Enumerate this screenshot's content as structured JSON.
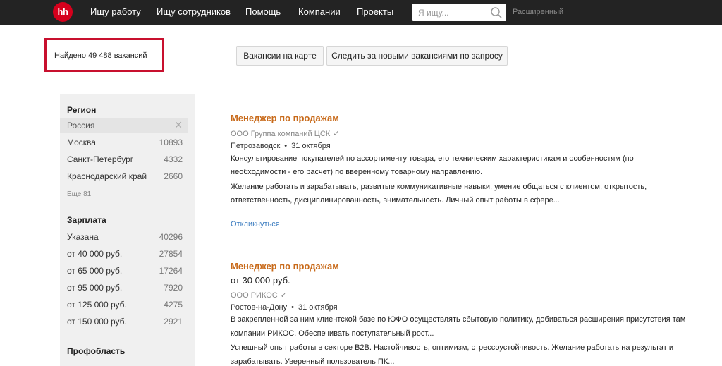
{
  "header": {
    "logo_text": "hh",
    "nav": [
      "Ищу работу",
      "Ищу сотрудников",
      "Помощь",
      "Компании",
      "Проекты"
    ],
    "search_placeholder": "Я ищу...",
    "advanced_label": "Расширенный"
  },
  "results": {
    "found_text": "Найдено 49 488 вакансий",
    "map_button": "Вакансии на карте",
    "subscribe_button": "Следить за новыми вакансиями по запросу"
  },
  "sidebar": {
    "region": {
      "title": "Регион",
      "selected": "Россия",
      "items": [
        {
          "label": "Москва",
          "count": "10893"
        },
        {
          "label": "Санкт-Петербург",
          "count": "4332"
        },
        {
          "label": "Краснодарский край",
          "count": "2660"
        }
      ],
      "more": "Еще 81"
    },
    "salary": {
      "title": "Зарплата",
      "items": [
        {
          "label": "Указана",
          "count": "40296"
        },
        {
          "label": "от 40 000 руб.",
          "count": "27854"
        },
        {
          "label": "от 65 000 руб.",
          "count": "17264"
        },
        {
          "label": "от 95 000 руб.",
          "count": "7920"
        },
        {
          "label": "от 125 000 руб.",
          "count": "4275"
        },
        {
          "label": "от 150 000 руб.",
          "count": "2921"
        }
      ]
    },
    "profarea": {
      "title": "Профобласть"
    }
  },
  "vacancies": [
    {
      "title": "Менеджер по продажам",
      "salary": "",
      "company": "ООО Группа компаний ЦСК",
      "city": "Петрозаводск",
      "date": "31 октября",
      "lines": [
        "Консультирование покупателей по ассортименту товара, его техническим характеристикам и особенностям (по",
        "необходимости - его расчет) по вверенному товарному направлению.",
        "Желание работать и зарабатывать, развитые коммуникативные навыки, умение общаться с клиентом, открытость,",
        "ответственность, дисциплинированность, внимательность. Личный опыт работы в сфере..."
      ],
      "respond": "Откликнуться"
    },
    {
      "title": "Менеджер по продажам",
      "salary": "от 30 000 руб.",
      "company": "ООО РИКОС",
      "city": "Ростов-на-Дону",
      "date": "31 октября",
      "lines": [
        "В закрепленной за ним клиентской базе по ЮФО осуществлять сбытовую политику, добиваться расширения присутствия там",
        "компании РИКОС. Обеспечивать поступательный рост...",
        "Успешный опыт работы в секторе B2B. Настойчивость, оптимизм, стрессоустойчивость. Желание работать на результат и",
        "зарабатывать. Уверенный пользователь ПК..."
      ]
    }
  ],
  "colors": {
    "topbar": "#232323",
    "logo": "#d6001c",
    "highlight_frame": "#c8102e",
    "vacancy_title": "#c86a1a",
    "link": "#3a7bbf"
  }
}
